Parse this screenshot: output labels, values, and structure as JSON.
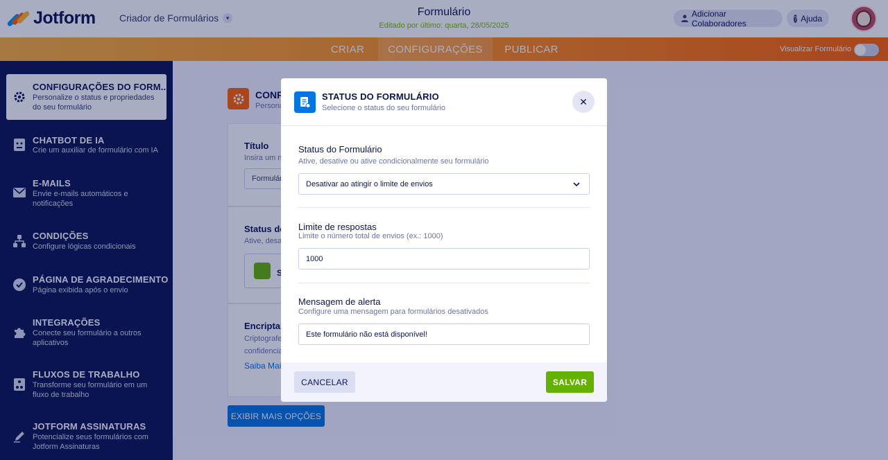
{
  "header": {
    "logo_text": "Jotform",
    "creator_label": "Criador de Formulários",
    "form_title": "Formulário",
    "edited": "Editado por último: quarta, 28/05/2025",
    "collab_label": "Adicionar Colaboradores",
    "help_label": "Ajuda"
  },
  "nav": {
    "tabs": [
      {
        "label": "CRIAR"
      },
      {
        "label": "CONFIGURAÇÕES"
      },
      {
        "label": "PUBLICAR"
      }
    ],
    "active_tab": "CONFIGURAÇÕES",
    "preview_label": "Visualizar Formulário"
  },
  "sidebar": {
    "items": [
      {
        "title": "CONFIGURAÇÕES DO FORM...",
        "desc": "Personalize o status e propriedades do seu formulário",
        "icon": "gear-icon"
      },
      {
        "title": "CHATBOT DE IA",
        "desc": "Crie um auxiliar de formulário com IA",
        "icon": "robot-icon"
      },
      {
        "title": "E-MAILS",
        "desc": "Envie e-mails automáticos e notificações",
        "icon": "envelope-icon"
      },
      {
        "title": "CONDIÇÕES",
        "desc": "Configure lógicas condicionais",
        "icon": "hierarchy-icon"
      },
      {
        "title": "PÁGINA DE AGRADECIMENTO",
        "desc": "Página exibida após o envio",
        "icon": "check-circle-icon"
      },
      {
        "title": "INTEGRAÇÕES",
        "desc": "Conecte seu formulário a outros aplicativos",
        "icon": "puzzle-icon"
      },
      {
        "title": "FLUXOS DE TRABALHO",
        "desc": "Transforme seu formulário em um fluxo de trabalho",
        "icon": "workflow-icon"
      },
      {
        "title": "JOTFORM ASSINATURAS",
        "desc": "Potencialize seus formulários com Jotform Assinaturas",
        "icon": "pen-icon"
      }
    ]
  },
  "main": {
    "title": "CONF",
    "subtitle": "Persona",
    "title_label": "Título",
    "title_sub": "Insira um n",
    "title_value": "Formulário",
    "status_label": "Status do",
    "status_sub": "Ative, desa",
    "status_card_letter": "S",
    "encrypt_label": "Encriptar",
    "encrypt_sub1": "Criptografe",
    "encrypt_sub2": "confidencia",
    "learn_more": "Saiba Mai",
    "more_options": "EXIBIR MAIS OPÇÕES"
  },
  "modal": {
    "title": "STATUS DO FORMULÁRIO",
    "subtitle": "Selecione o status do seu formulário",
    "status_label": "Status do Formulário",
    "status_sub": "Ative, desative ou ative condicionalmente seu formulário",
    "status_value": "Desativar ao atingir o limite de envios",
    "limit_label": "Limite de respostas",
    "limit_sub": "Limite o número total de envios (ex.: 1000)",
    "limit_value": "1000",
    "alert_label": "Mensagem de alerta",
    "alert_sub": "Configure uma mensagem para formulários desativados",
    "alert_value": "Este formulário não está disponível!",
    "cancel_label": "CANCELAR",
    "save_label": "SALVAR"
  },
  "colors": {
    "brand_navy": "#0a1551",
    "accent_orange": "#ff6100",
    "accent_blue": "#0075e3",
    "accent_green": "#64b200"
  }
}
